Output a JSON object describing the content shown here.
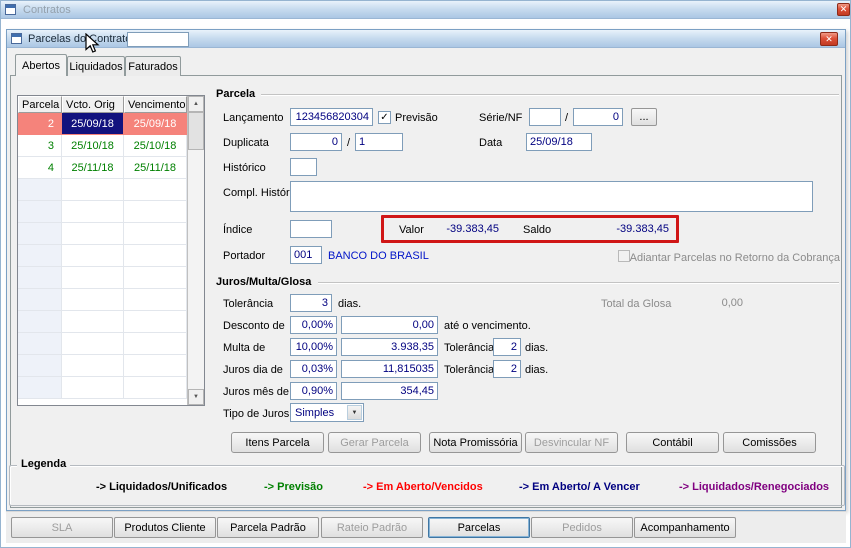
{
  "outer_window": {
    "title": "Contratos"
  },
  "inner_window": {
    "title": "Parcelas do Contrato -",
    "title_field_value": ""
  },
  "icons": {
    "close": "✕",
    "arrow_up": "▲",
    "arrow_down": "▼",
    "dropdown": "▼",
    "check": "✓"
  },
  "tabs": [
    {
      "label": "Abertos",
      "active": true
    },
    {
      "label": "Liquidados",
      "active": false
    },
    {
      "label": "Faturados",
      "active": false
    }
  ],
  "grid": {
    "columns": [
      "Parcela",
      "Vcto. Orig",
      "Vencimento"
    ],
    "rows": [
      {
        "parcela": "2",
        "vcto_orig": "25/09/18",
        "vencimento": "25/09/18",
        "state": "selected"
      },
      {
        "parcela": "3",
        "vcto_orig": "25/10/18",
        "vencimento": "25/10/18",
        "state": "previsao"
      },
      {
        "parcela": "4",
        "vcto_orig": "25/11/18",
        "vencimento": "25/11/18",
        "state": "previsao"
      }
    ]
  },
  "parcela": {
    "group_title": "Parcela",
    "lancamento": {
      "label": "Lançamento",
      "value": "123456820304"
    },
    "previsao_checkbox": {
      "label": "Previsão",
      "checked": true
    },
    "serie_nf": {
      "label": "Série/NF",
      "serie_value": "",
      "separator": "/",
      "nf_value": "0",
      "browse_label": "..."
    },
    "duplicata": {
      "label": "Duplicata",
      "value": "0",
      "separator": "/",
      "sequence": "1"
    },
    "data": {
      "label": "Data",
      "value": "25/09/18"
    },
    "historico": {
      "label": "Histórico",
      "value": ""
    },
    "compl_historico": {
      "label": "Compl. Histórico",
      "value": ""
    },
    "indice": {
      "label": "Índice",
      "value": ""
    },
    "valor": {
      "label": "Valor",
      "value": "-39.383,45"
    },
    "saldo": {
      "label": "Saldo",
      "value": "-39.383,45"
    },
    "portador": {
      "label": "Portador",
      "code": "001",
      "name": "BANCO DO BRASIL"
    },
    "adiantar_checkbox": {
      "label": "Adiantar Parcelas no Retorno da Cobrança",
      "checked": false,
      "enabled": false
    }
  },
  "juros": {
    "group_title": "Juros/Multa/Glosa",
    "tolerancia": {
      "label": "Tolerância",
      "value": "3",
      "suffix": "dias."
    },
    "total_glosa": {
      "label": "Total da Glosa",
      "value": "0,00"
    },
    "desconto": {
      "label": "Desconto de",
      "percent": "0,00%",
      "value": "0,00",
      "suffix": "até o vencimento."
    },
    "multa": {
      "label": "Multa de",
      "percent": "10,00%",
      "value": "3.938,35",
      "tolerancia_label": "Tolerância",
      "tolerancia_value": "2",
      "suffix": "dias."
    },
    "juros_dia": {
      "label": "Juros dia de",
      "percent": "0,03%",
      "value": "11,815035",
      "tolerancia_label": "Tolerância",
      "tolerancia_value": "2",
      "suffix": "dias."
    },
    "juros_mes": {
      "label": "Juros mês de",
      "percent": "0,90%",
      "value": "354,45"
    },
    "tipo_juros": {
      "label": "Tipo de Juros",
      "value": "Simples"
    }
  },
  "action_buttons": [
    {
      "label": "Itens Parcela",
      "enabled": true
    },
    {
      "label": "Gerar Parcela",
      "enabled": false
    },
    {
      "label": "Nota Promissória",
      "enabled": true
    },
    {
      "label": "Desvincular NF",
      "enabled": false
    },
    {
      "label": "Contábil",
      "enabled": true
    },
    {
      "label": "Comissões",
      "enabled": true
    }
  ],
  "legend": {
    "title": "Legenda",
    "items": [
      {
        "label": "-> Liquidados/Unificados",
        "color": "#000000"
      },
      {
        "label": "-> Previsão",
        "color": "#008000"
      },
      {
        "label": "-> Em Aberto/Vencidos",
        "color": "#ff0000"
      },
      {
        "label": "-> Em Aberto/ A Vencer",
        "color": "#000080"
      },
      {
        "label": "-> Liquidados/Renegociados",
        "color": "#800080"
      }
    ]
  },
  "bottom_buttons": [
    {
      "label": "SLA",
      "enabled": false
    },
    {
      "label": "Produtos Cliente",
      "enabled": true
    },
    {
      "label": "Parcela Padrão",
      "enabled": true
    },
    {
      "label": "Rateio Padrão",
      "enabled": false
    },
    {
      "label": "Parcelas",
      "enabled": true,
      "focused": true
    },
    {
      "label": "Pedidos",
      "enabled": false
    },
    {
      "label": "Acompanhamento",
      "enabled": true
    }
  ],
  "colors": {
    "selected_row": "#f5837b",
    "cell_selection": "#12127e",
    "previsao_text": "#008000",
    "field_value": "#000080",
    "annotation": "#d01616"
  }
}
